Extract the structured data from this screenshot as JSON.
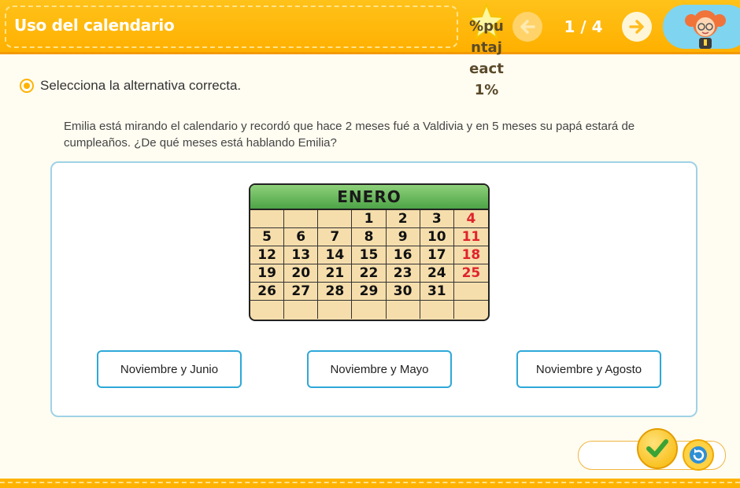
{
  "header": {
    "title": "Uso del calendario",
    "score_text": "%puntajeact1%",
    "page_indicator": "1 / 4",
    "prev_icon": "arrow-left-icon",
    "next_icon": "arrow-right-icon",
    "avatar_icon": "girl-avatar-icon"
  },
  "instruction": "Selecciona la alternativa correcta.",
  "question": "Emilia está mirando el calendario y recordó que hace 2 meses fué a Valdivia y en 5 meses su papá estará de cumpleaños. ¿De qué meses está hablando Emilia?",
  "calendar": {
    "month": "ENERO",
    "weeks": [
      [
        "",
        "",
        "",
        "1",
        "2",
        "3",
        "4"
      ],
      [
        "5",
        "6",
        "7",
        "8",
        "9",
        "10",
        "11"
      ],
      [
        "12",
        "13",
        "14",
        "15",
        "16",
        "17",
        "18"
      ],
      [
        "19",
        "20",
        "21",
        "22",
        "23",
        "24",
        "25"
      ],
      [
        "26",
        "27",
        "28",
        "29",
        "30",
        "31",
        ""
      ],
      [
        "",
        "",
        "",
        "",
        "",
        "",
        ""
      ]
    ]
  },
  "options": [
    {
      "label": "Noviembre y Junio"
    },
    {
      "label": "Noviembre y Mayo"
    },
    {
      "label": "Noviembre y Agosto"
    }
  ],
  "controls": {
    "check_icon": "checkmark-icon",
    "reload_icon": "reload-icon"
  },
  "colors": {
    "accent": "#ffb300",
    "option_border": "#2ea8d9",
    "weekend": "#e0232d",
    "calendar_header": "#4da447"
  }
}
